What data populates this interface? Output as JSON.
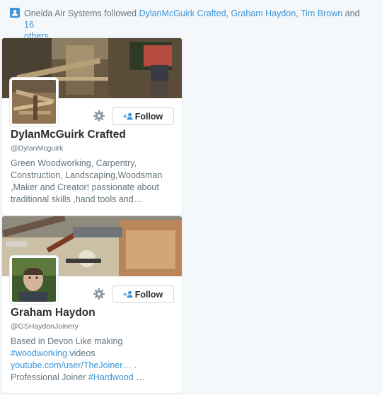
{
  "context": {
    "actor": "Oneida Air Systems",
    "verb": " followed ",
    "links": [
      "DylanMcGuirk Crafted",
      "Graham Haydon",
      "Tim Brown"
    ],
    "sep1": ", ",
    "sep2": ", ",
    "and": " and ",
    "others": "16",
    "others_line2": "others",
    "icon": "person-icon"
  },
  "cards": [
    {
      "name": "DylanMcGuirk Crafted",
      "handle": "@DylanMcguirk",
      "follow_label": "Follow",
      "bio_lines": [
        "Green Woodworking, Carpentry,",
        "Construction, Landscaping,Woodsman",
        ",Maker and Creator! passionate about",
        "traditional skills ,hand tools and…"
      ]
    },
    {
      "name": "Graham Haydon",
      "handle": "@GSHaydonJoinery",
      "follow_label": "Follow",
      "bio_line1": "Based in Devon Like making",
      "bio_hashtag1": "#woodworking",
      "bio_after1": " videos",
      "bio_link": "youtube.com/user/TheJoiner…",
      "bio_after_link": " .",
      "bio_line4_pre": "Professional Joiner ",
      "bio_hashtag2": "#Hardwood",
      "bio_line4_post": " …"
    }
  ],
  "colors": {
    "link": "#3b94d9",
    "muted": "#66757f",
    "text": "#292f33"
  }
}
